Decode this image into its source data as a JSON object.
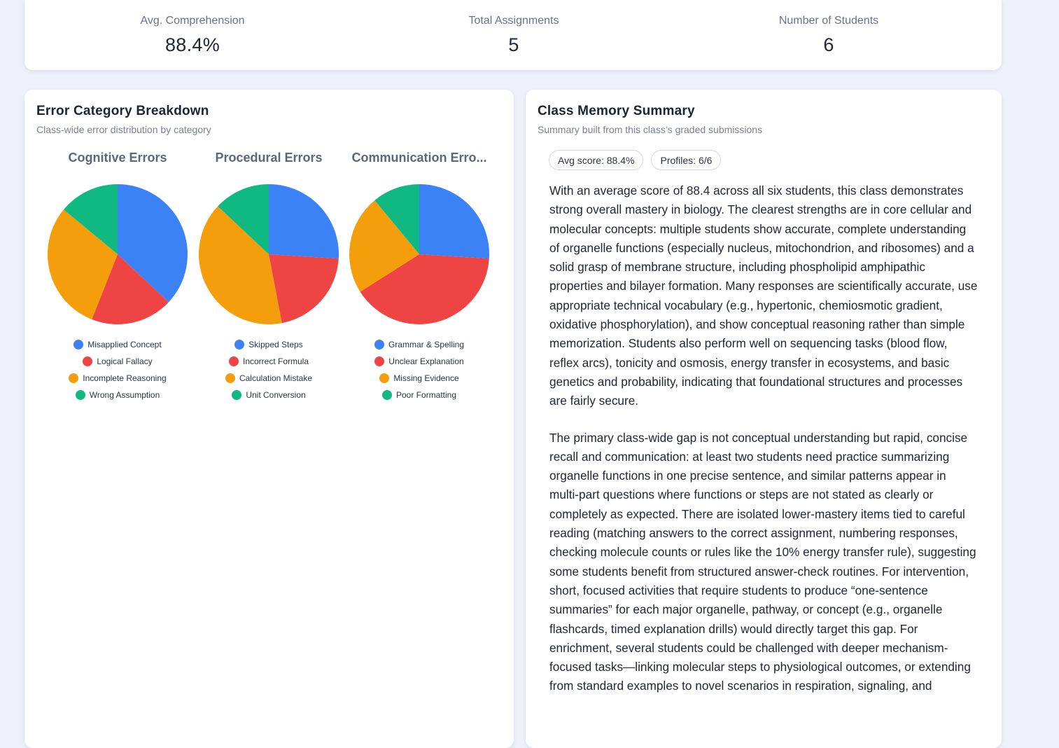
{
  "stats": {
    "avg_comprehension": {
      "label": "Avg. Comprehension",
      "value": "88.4%"
    },
    "total_assignments": {
      "label": "Total Assignments",
      "value": "5"
    },
    "number_of_students": {
      "label": "Number of Students",
      "value": "6"
    }
  },
  "error_panel": {
    "title": "Error Category Breakdown",
    "subtitle": "Class-wide error distribution by category"
  },
  "colors": {
    "blue": "#3b82f6",
    "red": "#ef4444",
    "orange": "#f59e0b",
    "green": "#10b981"
  },
  "chart_data": [
    {
      "type": "pie",
      "title": "Cognitive Errors",
      "categories": [
        "Misapplied Concept",
        "Logical Fallacy",
        "Incomplete Reasoning",
        "Wrong Assumption"
      ],
      "values": [
        37,
        19,
        30,
        14
      ]
    },
    {
      "type": "pie",
      "title": "Procedural Errors",
      "categories": [
        "Skipped Steps",
        "Incorrect Formula",
        "Calculation Mistake",
        "Unit Conversion"
      ],
      "values": [
        26,
        21,
        40,
        13
      ]
    },
    {
      "type": "pie",
      "title": "Communication Erro...",
      "categories": [
        "Grammar & Spelling",
        "Unclear Explanation",
        "Missing Evidence",
        "Poor Formatting"
      ],
      "values": [
        26,
        40,
        23,
        11
      ]
    }
  ],
  "memory_panel": {
    "title": "Class Memory Summary",
    "subtitle": "Summary built from this class’s graded submissions",
    "pills": [
      "Avg score: 88.4%",
      "Profiles: 6/6"
    ],
    "paragraphs": [
      "With an average score of 88.4 across all six students, this class demonstrates strong overall mastery in biology. The clearest strengths are in core cellular and molecular concepts: multiple students show accurate, complete understanding of organelle functions (especially nucleus, mitochondrion, and ribosomes) and a solid grasp of membrane structure, including phospholipid amphipathic properties and bilayer formation. Many responses are scientifically accurate, use appropriate technical vocabulary (e.g., hypertonic, chemiosmotic gradient, oxidative phosphorylation), and show conceptual reasoning rather than simple memorization. Students also perform well on sequencing tasks (blood flow, reflex arcs), tonicity and osmosis, energy transfer in ecosystems, and basic genetics and probability, indicating that foundational structures and processes are fairly secure.",
      "The primary class-wide gap is not conceptual understanding but rapid, concise recall and communication: at least two students need practice summarizing organelle functions in one precise sentence, and similar patterns appear in multi-part questions where functions or steps are not stated as clearly or completely as expected. There are isolated lower-mastery items tied to careful reading (matching answers to the correct assignment, numbering responses, checking molecule counts or rules like the 10% energy transfer rule), suggesting some students benefit from structured answer-check routines. For intervention, short, focused activities that require students to produce “one-sentence summaries” for each major organelle, pathway, or concept (e.g., organelle flashcards, timed explanation drills) would directly target this gap. For enrichment, several students could be challenged with deeper mechanism-focused tasks—linking molecular steps to physiological outcomes, or extending from standard examples to novel scenarios in respiration, signaling, and"
    ]
  }
}
